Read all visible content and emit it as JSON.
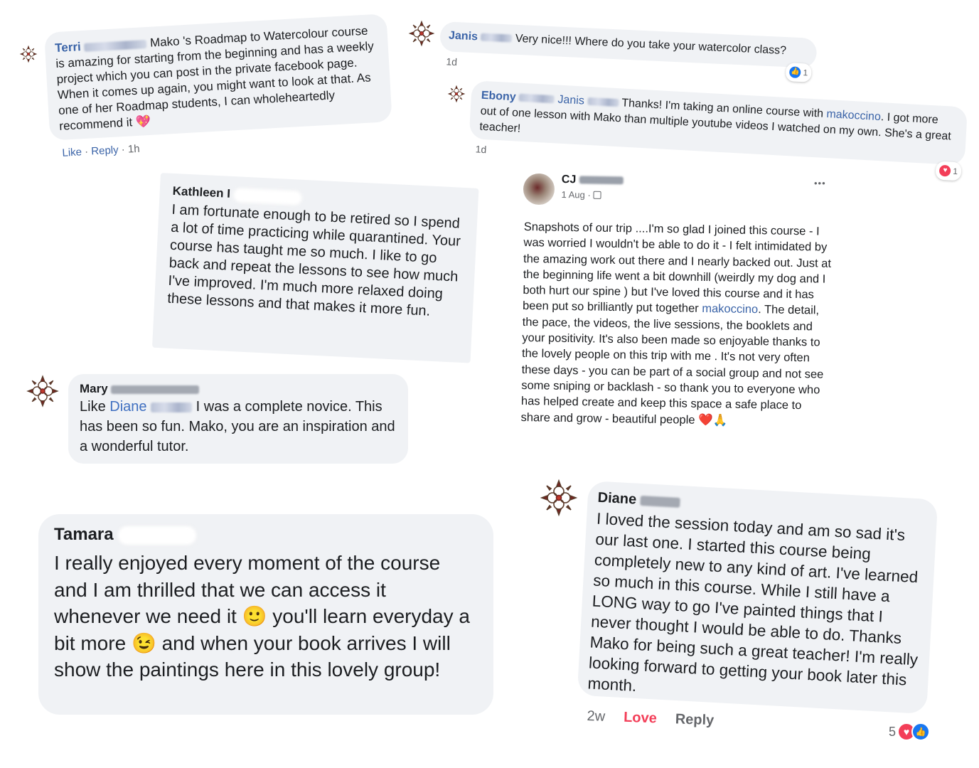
{
  "terri": {
    "name": "Terri",
    "text": "Mako 's Roadmap to Watercolour course is amazing for starting from the beginning and has a weekly project which you can post in the private facebook page. When it comes up again, you might want to look at that. As one of her Roadmap students, I can wholeheartedly recommend it",
    "emoji": "💖",
    "like": "Like",
    "sep1": " · ",
    "reply": "Reply",
    "sep2": " · ",
    "time": "1h"
  },
  "janis": {
    "name": "Janis",
    "text": "Very nice!!! Where do you take your watercolor class?",
    "time": "1d",
    "reaction_count": "1"
  },
  "ebony": {
    "name": "Ebony",
    "tag": "Janis",
    "text_a": "Thanks! I'm taking an online course with ",
    "link": "makoccino",
    "text_b": ". I got more out of one lesson with Mako than multiple youtube videos I watched on my own. She's a great teacher!",
    "time": "1d",
    "reaction_count": "1"
  },
  "kathleen": {
    "name": "Kathleen I",
    "text": "I am fortunate enough to be retired so I spend a lot of time practicing while quarantined. Your course has taught me so much. I like to go back and repeat the lessons to see how much I've improved. I'm much more relaxed doing these lessons and that makes it more fun."
  },
  "cj": {
    "name": "CJ",
    "date": "1 Aug ·",
    "more": "•••",
    "text_a": "Snapshots of our trip ....I'm so glad I joined this course - I was worried I wouldn't be able to do it - I felt intimidated by the amazing work out there and I nearly backed out. Just at the beginning life went a bit downhill (weirdly my dog and I both hurt our spine ) but I've loved this course and it has been put so brilliantly put together ",
    "link": "makoccino",
    "text_b": ". The detail, the pace, the videos,  the live sessions, the booklets and your positivity.  It's also been made so enjoyable thanks to the lovely people on this trip with me . It's not very often these days - you can be part of a social group and not see some sniping or backlash - so thank you to everyone who has helped create and keep this space a safe place to share and grow - beautiful people",
    "emoji": "❤️🙏"
  },
  "mary": {
    "name": "Mary",
    "like_word": "Like ",
    "tag": "Diane",
    "text": " I was a complete novice. This has been so fun. Mako, you are an inspiration and a wonderful tutor."
  },
  "tamara": {
    "name": "Tamara",
    "text_a": "I really enjoyed every moment of the course and I am thrilled that we can access it whenever we need it ",
    "emoji1": "🙂",
    "text_b": " you'll learn everyday a bit more ",
    "emoji2": "😉",
    "text_c": " and when your book arrives I will show the paintings here in this lovely group!"
  },
  "diane": {
    "name": "Diane",
    "text": "I loved the session today and am so sad it's our last one. I started this course being completely new to any kind of art. I've learned so much in this course. While I still have a LONG way to go I've painted things that I never thought I would be able to do. Thanks Mako for being such a great teacher! I'm really looking forward to getting your book later this month.",
    "time": "2w",
    "love": "Love",
    "reply": "Reply",
    "reaction_count": "5"
  },
  "icons": {
    "avatar": "flower-logo-icon",
    "like": "thumbs-up-icon",
    "love": "heart-icon",
    "globe": "friends-icon"
  },
  "colors": {
    "bubble": "#f0f2f5",
    "link": "#3b64a8",
    "love": "#f33e58",
    "like": "#1877f2"
  }
}
